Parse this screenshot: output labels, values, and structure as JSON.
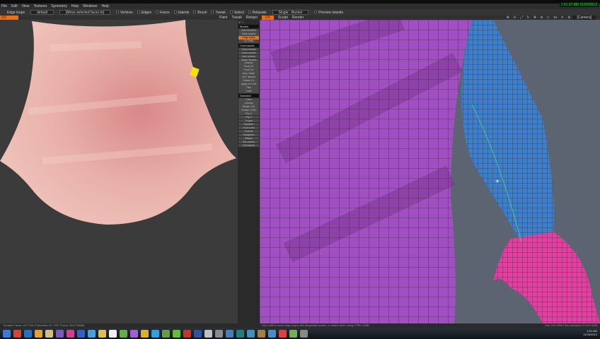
{
  "menu": [
    "File",
    "Edit",
    "View",
    "Textures",
    "Symmetry",
    "Help",
    "Windows",
    "Help"
  ],
  "clock": "1:51:37 AM 11/26/2012",
  "toolbar": {
    "tool": "Edge loops",
    "preset": "default",
    "mode": "[Move selected faces to]",
    "checks": [
      "Vertices",
      "Edges",
      "Faces",
      "Islands",
      "Brush",
      "Tweak",
      "Select",
      "Relaxate"
    ],
    "group": "Single - Bucket",
    "preview": "Preview islands"
  },
  "uv_preview_label": "UV preview",
  "rooms": [
    "Paint",
    "Tweak",
    "Retopo",
    "UV",
    "Sculpt",
    "Render"
  ],
  "active_room": "UV",
  "camera": "[Camera]",
  "panel": {
    "modes_header": "Modes",
    "modes": [
      "Add Clusters",
      "Mark seams",
      "Edge loops",
      "UV Path"
    ],
    "commands_header": "Commands",
    "commands": [
      "Clear seams",
      "Clear seams",
      "Auto seams",
      "Sharp Seams",
      "Unwrap",
      "Pack UV",
      "Pack UV",
      "Auto Scale",
      "UnF Islands",
      "Rotate UV",
      "Apply UV-Set",
      "Tiles",
      "Load"
    ],
    "selected_header": "Selected",
    "selected": [
      "Clear",
      "Unwrap",
      "Rotate CW",
      "Rotate CCW",
      "Flip U",
      "Flip V",
      "To grid",
      "Equalize",
      "Horizontal",
      "Vertical",
      "Straighten",
      "Ellipse",
      "Set seams",
      "Del seams"
    ]
  },
  "status_left": "Tunable   Faces: 8177 ML-Polimetric: 67 TXR: Faces: 36477/8688",
  "status_hint": "Use LMB to mark edge loops with tangential seams, or select them using CTRL+LMB",
  "status_right": "Use Ctrl+Shift+Sub-selection 2+Ctrl+Shift",
  "tray": {
    "time": "1:51 AM",
    "date": "11/26/2012"
  },
  "taskbar_colors": [
    "#3a7bd5",
    "#e04030",
    "#2a70c0",
    "#e8a020",
    "#d0c080",
    "#7a5ac0",
    "#d04090",
    "#3060d0",
    "#40a0e0",
    "#e0c040",
    "#f0f0f0",
    "#60b040",
    "#a060d0",
    "#e0b020",
    "#30a0e0",
    "#60a040",
    "#60c030",
    "#d03020",
    "#3050a0",
    "#c0c0c0",
    "#8a8a8a",
    "#4080c0",
    "#208080",
    "#4090c0",
    "#a08040",
    "#4090d0",
    "#e04040",
    "#70b050",
    "#888888"
  ]
}
